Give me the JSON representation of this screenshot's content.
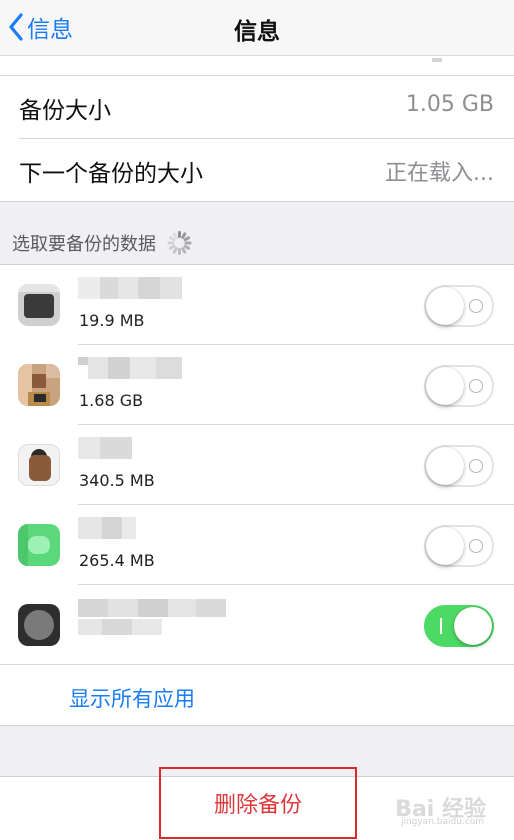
{
  "nav": {
    "back_label": "信息",
    "title": "信息"
  },
  "backup": {
    "size_label": "备份大小",
    "size_value": "1.05 GB",
    "next_label": "下一个备份的大小",
    "next_value": "正在载入..."
  },
  "section": {
    "title": "选取要备份的数据"
  },
  "apps": [
    {
      "size": "19.9 MB",
      "enabled": false,
      "icon_color": "#3a3a3a"
    },
    {
      "size": "1.68 GB",
      "enabled": false,
      "icon_color": "#9a6b4a"
    },
    {
      "size": "340.5 MB",
      "enabled": false,
      "icon_color": "#8a5a3a"
    },
    {
      "size": "265.4 MB",
      "enabled": false,
      "icon_color": "#5ad87a"
    },
    {
      "size": "",
      "enabled": true,
      "icon_color": "#3a3a3a"
    }
  ],
  "show_all_label": "显示所有应用",
  "delete_label": "删除备份",
  "watermark": {
    "text": "Bai 经验",
    "sub": "jingyan.baidu.com"
  },
  "colors": {
    "accent": "#1a7cf6",
    "destructive": "#e0393b",
    "switch_on": "#4cd964"
  }
}
